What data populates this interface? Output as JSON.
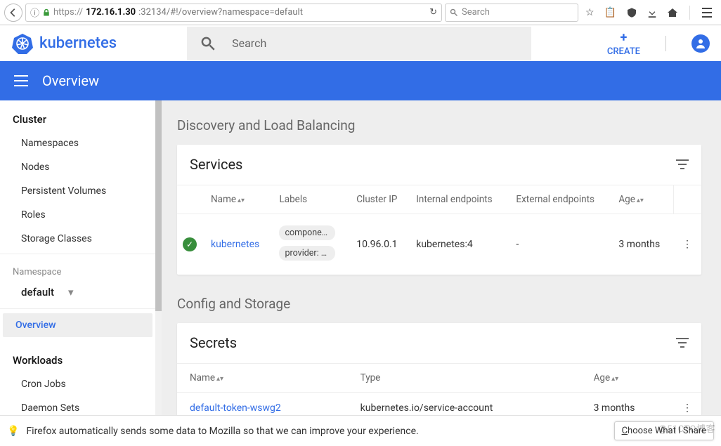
{
  "browser": {
    "scheme": "https://",
    "host": "172.16.1.30",
    "port_path": ":32134/#!/overview?namespace=default",
    "search_placeholder": "Search"
  },
  "app": {
    "brand": "kubernetes",
    "search_placeholder": "Search",
    "create_label": "CREATE"
  },
  "toolbar": {
    "title": "Overview"
  },
  "sidebar": {
    "cluster_head": "Cluster",
    "cluster_items": [
      "Namespaces",
      "Nodes",
      "Persistent Volumes",
      "Roles",
      "Storage Classes"
    ],
    "ns_label": "Namespace",
    "ns_value": "default",
    "overview": "Overview",
    "workloads_head": "Workloads",
    "workloads_items": [
      "Cron Jobs",
      "Daemon Sets"
    ]
  },
  "sections": {
    "discovery_title": "Discovery and Load Balancing",
    "config_title": "Config and Storage"
  },
  "services": {
    "title": "Services",
    "cols": {
      "name": "Name",
      "labels": "Labels",
      "clusterip": "Cluster IP",
      "intep": "Internal endpoints",
      "extep": "External endpoints",
      "age": "Age"
    },
    "row": {
      "name": "kubernetes",
      "chip1": "component:",
      "chip2": "provider: k…",
      "clusterip": "10.96.0.1",
      "intep": "kubernetes:4",
      "extep": "-",
      "age": "3 months"
    }
  },
  "secrets": {
    "title": "Secrets",
    "cols": {
      "name": "Name",
      "type": "Type",
      "age": "Age"
    },
    "row": {
      "name": "default-token-wswg2",
      "type": "kubernetes.io/service-account",
      "age": "3 months"
    }
  },
  "footer": {
    "text": "Firefox automatically sends some data to Mozilla so that we can improve your experience.",
    "choose_u": "C",
    "choose_rest": "hoose What I Share"
  },
  "watermark": "@51CTO博客"
}
